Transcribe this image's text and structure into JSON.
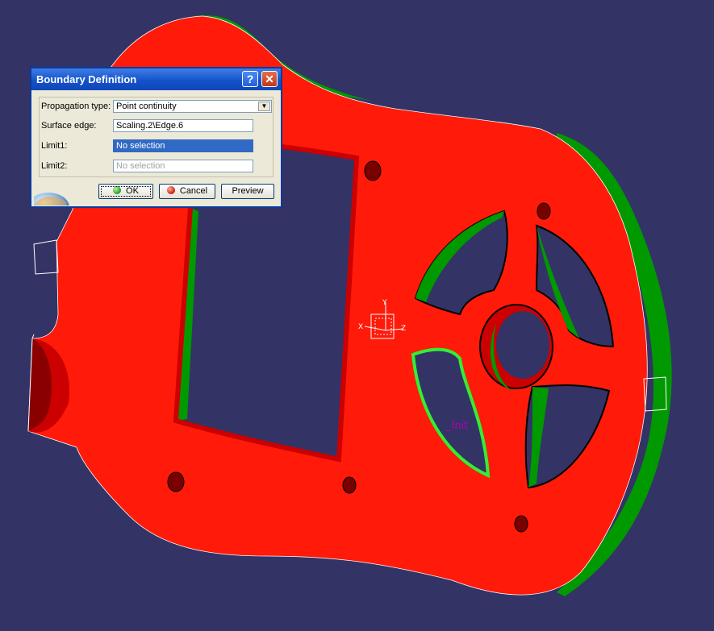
{
  "window": {
    "background": "#333366"
  },
  "viewport": {
    "part_color": "#ff1a0a",
    "side_color": "#009900",
    "axis_labels": {
      "x": "X",
      "y": "Y",
      "z": "Z"
    },
    "init_label": "_Init"
  },
  "dialog": {
    "title": "Boundary Definition",
    "help_glyph": "?",
    "close_glyph": "✕",
    "propagation_type_label": "Propagation type:",
    "propagation_type_value": "Point continuity",
    "surface_edge_label": "Surface edge:",
    "surface_edge_value": "Scaling.2\\Edge.6",
    "limit1_label": "Limit1:",
    "limit1_value": "No selection",
    "limit2_label": "Limit2:",
    "limit2_value": "No selection",
    "ok_label": "OK",
    "cancel_label": "Cancel",
    "preview_label": "Preview",
    "dropdown_arrow": "▼"
  }
}
